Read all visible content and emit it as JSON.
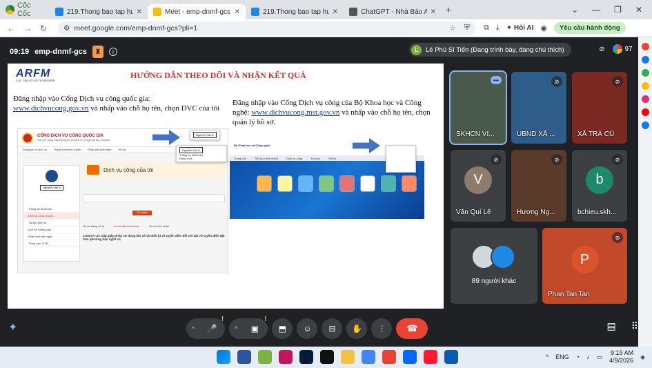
{
  "browser": {
    "brand": "Cốc Cốc",
    "tabs": [
      {
        "title": "219.Thong bao tap huan ve cap",
        "color": "#1e88e5",
        "active": false
      },
      {
        "title": "Meet - emp-dnmf-gcs",
        "color": "#fbbc04",
        "active": true
      },
      {
        "title": "219.Thong bao tap huan ve cap",
        "color": "#1e88e5",
        "active": false
      },
      {
        "title": "ChatGPT - Nhà Báo AI Pro",
        "color": "#555555",
        "active": false
      }
    ],
    "url": "meet.google.com/emp-dnmf-gcs?pli=1",
    "hoi_ai": "Hỏi AI",
    "action_button": "Yêu cầu hành động"
  },
  "meet": {
    "time": "09:19",
    "code": "emp-dnmf-gcs",
    "presenter_initial": "L",
    "presenter": "Lê Phú Sĩ Tiến (Đang trình bày, đang chú thích)",
    "participant_count": "97",
    "tiles": [
      {
        "label": "SKHCN VI...",
        "bg": "#4a5a4a",
        "selected": true
      },
      {
        "label": "UBND XÃ ...",
        "bg": "#2f5d8a"
      },
      {
        "label": "XÃ TRÀ CÚ",
        "bg": "#7a2a22"
      },
      {
        "label": "Văn Quí Lê",
        "letter": "V",
        "bg": "#3c4043",
        "letter_bg": "#8d7b6e"
      },
      {
        "label": "Hương Ng...",
        "bg": "#5a3b2a"
      },
      {
        "label": "bchieu.skh...",
        "letter": "b",
        "bg": "#3c4043",
        "letter_bg": "#1b8a6b"
      },
      {
        "label": "89 người khác",
        "others": true
      },
      {
        "label": "Phan Tan Tan",
        "letter": "P",
        "bg": "#c24a2a",
        "letter_bg": "#d9532c"
      }
    ]
  },
  "slide": {
    "brand": "ARFM",
    "brand_sub": "CỤC TẦN SỐ VÔ TUYẾN ĐIỆN",
    "title": "HƯỚNG DẪN THEO DÕI VÀ NHẬN KẾT QUẢ",
    "left_pre": "Đăng nhập vào Cổng Dịch vụ công quốc gia:",
    "left_link": "www.dichvucong.gov.vn",
    "left_post": " và nhấp vào chỗ họ tên, chọn DVC của tôi",
    "right_pre": "Đăng nhập vào Cổng Dịch vụ công của Bộ Khoa học và Công nghệ: ",
    "right_link": "www.dichvucong.mst.gov.vn",
    "right_post": " và nhấp vào chỗ họ tên, chọn quản lý hồ sơ.",
    "shot1": {
      "portal": "CỔNG DỊCH VỤ CÔNG QUỐC GIA",
      "portal_sub": "Kết nối, cung cấp thông tin và dịch vụ công mọi lúc, mọi nơi",
      "menu": [
        "Thông tin và dịch vụ",
        "Thanh toán trực tuyến",
        "Phản ánh kiến nghị",
        "Hỗ trợ"
      ],
      "user": "Nguyễn Văn A",
      "popup": [
        "Thông tin tài khoản",
        "Đăng xuất"
      ],
      "section": "Dịch vụ công của tôi",
      "side": [
        "Thông tin tài khoản",
        "Dịch vụ công của tôi",
        "Tài liệu điện tử",
        "Lịch sử thanh toán",
        "Phản ánh kiến nghị",
        "Tham vấn TTHC"
      ],
      "search_btn": "Tìm kiếm",
      "tabs": [
        "Hồ sơ đang xử lý",
        "Hồ sơ đã hoàn thành",
        "Hồ sơ chờ nhận"
      ],
      "code": "2.002777.01 Cấp giấy phép sử dụng tần số và thiết bị vô tuyến điện đối với đài vô tuyến điện đặt trên phương tiện nghề cá"
    },
    "shot2": {
      "header": "Bộ Khoa học và Công nghệ",
      "menu": [
        "Trang chủ",
        "Thủ tục hành chính",
        "Dịch vụ công",
        "Tra cứu",
        "Hỗ trợ"
      ]
    }
  },
  "taskbar": {
    "lang": "ENG",
    "time": "9:19 AM",
    "date": "4/9/2026"
  }
}
